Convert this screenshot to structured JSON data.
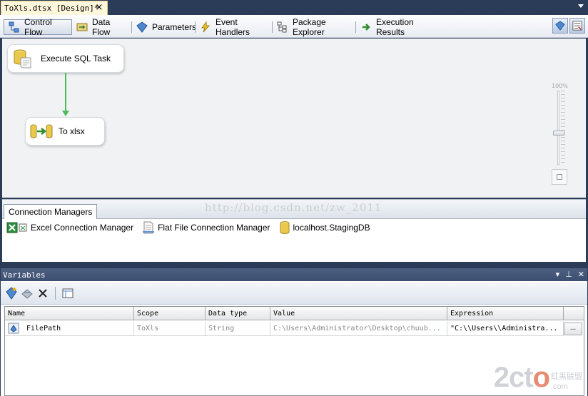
{
  "document_tab": {
    "title": "ToXls.dtsx [Design]*",
    "close_glyph": "×"
  },
  "designer_tabs": [
    {
      "label": "Control Flow",
      "icon": "control-flow-icon",
      "active": true
    },
    {
      "label": "Data Flow",
      "icon": "data-flow-icon"
    },
    {
      "label": "Parameters",
      "icon": "parameters-icon"
    },
    {
      "label": "Event Handlers",
      "icon": "event-handlers-icon"
    },
    {
      "label": "Package Explorer",
      "icon": "package-explorer-icon"
    },
    {
      "label": "Execution Results",
      "icon": "execution-results-icon"
    }
  ],
  "canvas": {
    "tasks": [
      {
        "label": "Execute SQL Task",
        "icon": "sql-task-icon"
      },
      {
        "label": "To xlsx",
        "icon": "data-flow-task-icon"
      }
    ],
    "zoom_label": "100%",
    "precedence_color": "#4cbb5a"
  },
  "connection_managers": {
    "tab_label": "Connection Managers",
    "items": [
      {
        "label": "Excel Connection Manager",
        "icon": "excel-connection-icon"
      },
      {
        "label": "Flat File Connection Manager",
        "icon": "flat-file-connection-icon"
      },
      {
        "label": "localhost.StagingDB",
        "icon": "database-connection-icon"
      }
    ],
    "watermark": "http://blog.csdn.net/zw_2011"
  },
  "variables": {
    "title": "Variables",
    "window_controls": {
      "dropdown": "▾",
      "pin": "⊥",
      "close": "✕"
    },
    "columns": [
      "Name",
      "Scope",
      "Data type",
      "Value",
      "Expression"
    ],
    "rows": [
      {
        "name": "FilePath",
        "scope": "ToXls",
        "data_type": "String",
        "value": "C:\\Users\\Administrator\\Desktop\\chuub...",
        "expression": "\"C:\\\\Users\\\\Administra...",
        "button": "..."
      }
    ]
  },
  "logo": {
    "main_prefix": "2",
    "main_c": "c",
    "main_t": "t",
    "main_o": "o",
    "cn": "红黑联盟",
    "dom": ".com"
  },
  "colors": {
    "accent_blue": "#2b3c59",
    "tab_active_yellow": "#fff7dc"
  }
}
